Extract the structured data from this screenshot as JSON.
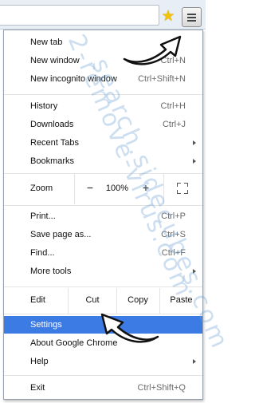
{
  "toolbar": {
    "star_icon": "star-icon",
    "menu_icon": "hamburger-menu-icon"
  },
  "menu": {
    "group1": [
      {
        "label": "New tab",
        "shortcut": ""
      },
      {
        "label": "New window",
        "shortcut": "Ctrl+N"
      },
      {
        "label": "New incognito window",
        "shortcut": "Ctrl+Shift+N"
      }
    ],
    "group2": [
      {
        "label": "History",
        "shortcut": "Ctrl+H"
      },
      {
        "label": "Downloads",
        "shortcut": "Ctrl+J"
      },
      {
        "label": "Recent Tabs",
        "shortcut": ""
      },
      {
        "label": "Bookmarks",
        "shortcut": ""
      }
    ],
    "zoom": {
      "label": "Zoom",
      "minus": "−",
      "value": "100%",
      "plus": "+"
    },
    "group3": [
      {
        "label": "Print...",
        "shortcut": "Ctrl+P"
      },
      {
        "label": "Save page as...",
        "shortcut": "Ctrl+S"
      },
      {
        "label": "Find...",
        "shortcut": "Ctrl+F"
      },
      {
        "label": "More tools",
        "shortcut": ""
      }
    ],
    "edit": {
      "label": "Edit",
      "cut": "Cut",
      "copy": "Copy",
      "paste": "Paste"
    },
    "group4": [
      {
        "label": "Settings",
        "shortcut": ""
      },
      {
        "label": "About Google Chrome",
        "shortcut": ""
      },
      {
        "label": "Help",
        "shortcut": ""
      }
    ],
    "exit": {
      "label": "Exit",
      "shortcut": "Ctrl+Shift+Q"
    }
  },
  "watermark": {
    "line1": "2-remove-virus.com",
    "line2": "search.sidecubes.com"
  },
  "colors": {
    "highlight": "#3c7ae4"
  }
}
